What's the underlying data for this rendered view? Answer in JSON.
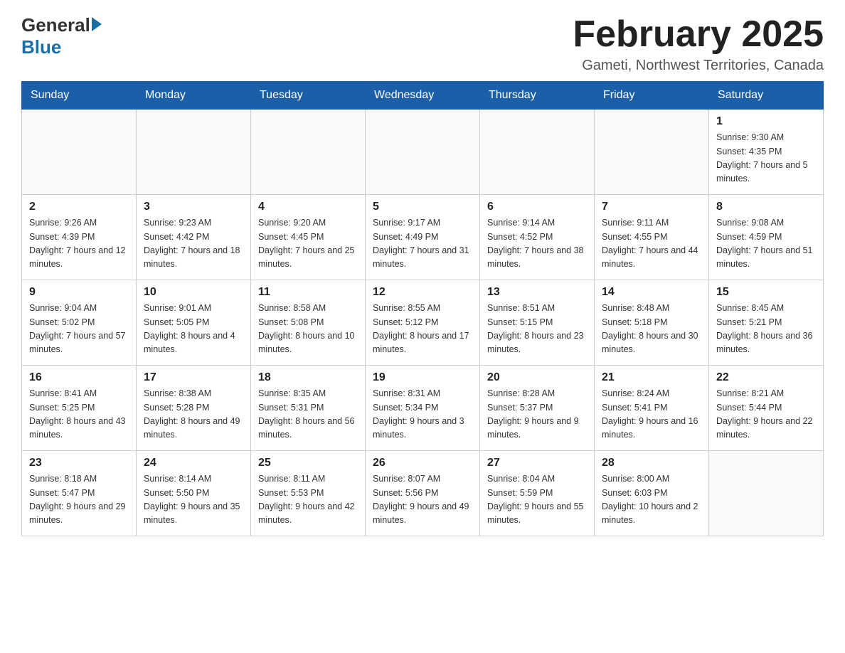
{
  "header": {
    "logo": {
      "general": "General",
      "blue": "Blue"
    },
    "title": "February 2025",
    "location": "Gameti, Northwest Territories, Canada"
  },
  "days_of_week": [
    "Sunday",
    "Monday",
    "Tuesday",
    "Wednesday",
    "Thursday",
    "Friday",
    "Saturday"
  ],
  "weeks": [
    [
      {
        "day": "",
        "info": ""
      },
      {
        "day": "",
        "info": ""
      },
      {
        "day": "",
        "info": ""
      },
      {
        "day": "",
        "info": ""
      },
      {
        "day": "",
        "info": ""
      },
      {
        "day": "",
        "info": ""
      },
      {
        "day": "1",
        "info": "Sunrise: 9:30 AM\nSunset: 4:35 PM\nDaylight: 7 hours and 5 minutes."
      }
    ],
    [
      {
        "day": "2",
        "info": "Sunrise: 9:26 AM\nSunset: 4:39 PM\nDaylight: 7 hours and 12 minutes."
      },
      {
        "day": "3",
        "info": "Sunrise: 9:23 AM\nSunset: 4:42 PM\nDaylight: 7 hours and 18 minutes."
      },
      {
        "day": "4",
        "info": "Sunrise: 9:20 AM\nSunset: 4:45 PM\nDaylight: 7 hours and 25 minutes."
      },
      {
        "day": "5",
        "info": "Sunrise: 9:17 AM\nSunset: 4:49 PM\nDaylight: 7 hours and 31 minutes."
      },
      {
        "day": "6",
        "info": "Sunrise: 9:14 AM\nSunset: 4:52 PM\nDaylight: 7 hours and 38 minutes."
      },
      {
        "day": "7",
        "info": "Sunrise: 9:11 AM\nSunset: 4:55 PM\nDaylight: 7 hours and 44 minutes."
      },
      {
        "day": "8",
        "info": "Sunrise: 9:08 AM\nSunset: 4:59 PM\nDaylight: 7 hours and 51 minutes."
      }
    ],
    [
      {
        "day": "9",
        "info": "Sunrise: 9:04 AM\nSunset: 5:02 PM\nDaylight: 7 hours and 57 minutes."
      },
      {
        "day": "10",
        "info": "Sunrise: 9:01 AM\nSunset: 5:05 PM\nDaylight: 8 hours and 4 minutes."
      },
      {
        "day": "11",
        "info": "Sunrise: 8:58 AM\nSunset: 5:08 PM\nDaylight: 8 hours and 10 minutes."
      },
      {
        "day": "12",
        "info": "Sunrise: 8:55 AM\nSunset: 5:12 PM\nDaylight: 8 hours and 17 minutes."
      },
      {
        "day": "13",
        "info": "Sunrise: 8:51 AM\nSunset: 5:15 PM\nDaylight: 8 hours and 23 minutes."
      },
      {
        "day": "14",
        "info": "Sunrise: 8:48 AM\nSunset: 5:18 PM\nDaylight: 8 hours and 30 minutes."
      },
      {
        "day": "15",
        "info": "Sunrise: 8:45 AM\nSunset: 5:21 PM\nDaylight: 8 hours and 36 minutes."
      }
    ],
    [
      {
        "day": "16",
        "info": "Sunrise: 8:41 AM\nSunset: 5:25 PM\nDaylight: 8 hours and 43 minutes."
      },
      {
        "day": "17",
        "info": "Sunrise: 8:38 AM\nSunset: 5:28 PM\nDaylight: 8 hours and 49 minutes."
      },
      {
        "day": "18",
        "info": "Sunrise: 8:35 AM\nSunset: 5:31 PM\nDaylight: 8 hours and 56 minutes."
      },
      {
        "day": "19",
        "info": "Sunrise: 8:31 AM\nSunset: 5:34 PM\nDaylight: 9 hours and 3 minutes."
      },
      {
        "day": "20",
        "info": "Sunrise: 8:28 AM\nSunset: 5:37 PM\nDaylight: 9 hours and 9 minutes."
      },
      {
        "day": "21",
        "info": "Sunrise: 8:24 AM\nSunset: 5:41 PM\nDaylight: 9 hours and 16 minutes."
      },
      {
        "day": "22",
        "info": "Sunrise: 8:21 AM\nSunset: 5:44 PM\nDaylight: 9 hours and 22 minutes."
      }
    ],
    [
      {
        "day": "23",
        "info": "Sunrise: 8:18 AM\nSunset: 5:47 PM\nDaylight: 9 hours and 29 minutes."
      },
      {
        "day": "24",
        "info": "Sunrise: 8:14 AM\nSunset: 5:50 PM\nDaylight: 9 hours and 35 minutes."
      },
      {
        "day": "25",
        "info": "Sunrise: 8:11 AM\nSunset: 5:53 PM\nDaylight: 9 hours and 42 minutes."
      },
      {
        "day": "26",
        "info": "Sunrise: 8:07 AM\nSunset: 5:56 PM\nDaylight: 9 hours and 49 minutes."
      },
      {
        "day": "27",
        "info": "Sunrise: 8:04 AM\nSunset: 5:59 PM\nDaylight: 9 hours and 55 minutes."
      },
      {
        "day": "28",
        "info": "Sunrise: 8:00 AM\nSunset: 6:03 PM\nDaylight: 10 hours and 2 minutes."
      },
      {
        "day": "",
        "info": ""
      }
    ]
  ]
}
